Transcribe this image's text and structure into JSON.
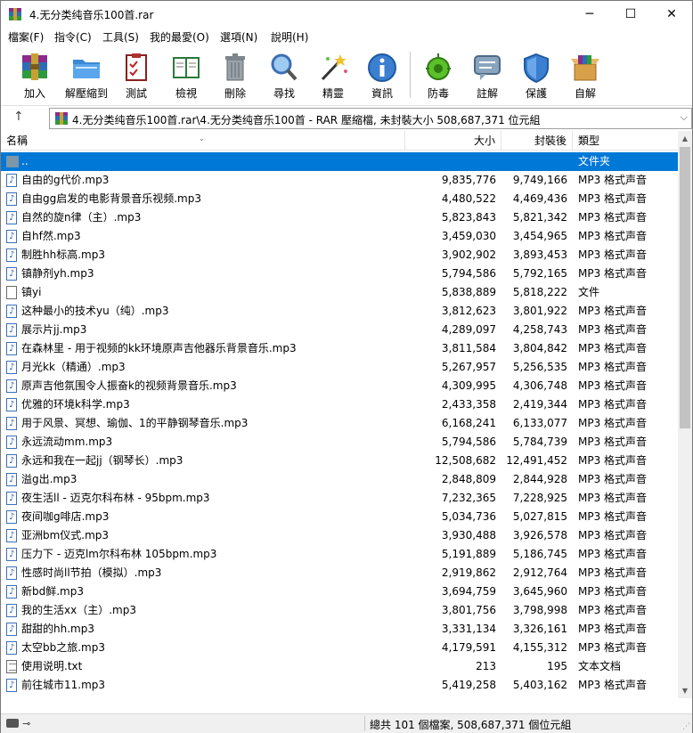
{
  "window": {
    "title": "4.无分类纯音乐100首.rar",
    "min_glyph": "─",
    "max_glyph": "☐",
    "close_glyph": "✕"
  },
  "menu": [
    "檔案(F)",
    "指令(C)",
    "工具(S)",
    "我的最愛(O)",
    "選項(N)",
    "說明(H)"
  ],
  "toolbar": {
    "add": "加入",
    "extract": "解壓縮到",
    "test": "測試",
    "view": "檢視",
    "delete": "刪除",
    "find": "尋找",
    "wizard": "精靈",
    "info": "資訊",
    "virus": "防毒",
    "comment": "註解",
    "protect": "保護",
    "sfx": "自解"
  },
  "address": {
    "up_glyph": "↑",
    "path": "4.无分类纯音乐100首.rar\\4.无分类纯音乐100首 - RAR 壓縮檔, 未封裝大小 508,687,371 位元組",
    "dropdown_glyph": "⌵"
  },
  "columns": {
    "name": "名稱",
    "size": "大小",
    "packed": "封裝後",
    "type": "類型"
  },
  "parent_row": {
    "name": "..",
    "type": "文件夹"
  },
  "files": [
    {
      "name": "自由的g代价.mp3",
      "size": "9,835,776",
      "packed": "9,749,166",
      "type": "MP3 格式声音",
      "kind": "audio"
    },
    {
      "name": "自由gg启发的电影背景音乐视频.mp3",
      "size": "4,480,522",
      "packed": "4,469,436",
      "type": "MP3 格式声音",
      "kind": "audio"
    },
    {
      "name": "自然的旋n律（主）.mp3",
      "size": "5,823,843",
      "packed": "5,821,342",
      "type": "MP3 格式声音",
      "kind": "audio"
    },
    {
      "name": "自hf然.mp3",
      "size": "3,459,030",
      "packed": "3,454,965",
      "type": "MP3 格式声音",
      "kind": "audio"
    },
    {
      "name": "制胜hh标高.mp3",
      "size": "3,902,902",
      "packed": "3,893,453",
      "type": "MP3 格式声音",
      "kind": "audio"
    },
    {
      "name": "镇静剂yh.mp3",
      "size": "5,794,586",
      "packed": "5,792,165",
      "type": "MP3 格式声音",
      "kind": "audio"
    },
    {
      "name": "镇yi",
      "size": "5,838,889",
      "packed": "5,818,222",
      "type": "文件",
      "kind": "plain"
    },
    {
      "name": "这种最小的技术yu（纯）.mp3",
      "size": "3,812,623",
      "packed": "3,801,922",
      "type": "MP3 格式声音",
      "kind": "audio"
    },
    {
      "name": "展示片jj.mp3",
      "size": "4,289,097",
      "packed": "4,258,743",
      "type": "MP3 格式声音",
      "kind": "audio"
    },
    {
      "name": "在森林里 - 用于视频的kk环境原声吉他器乐背景音乐.mp3",
      "size": "3,811,584",
      "packed": "3,804,842",
      "type": "MP3 格式声音",
      "kind": "audio"
    },
    {
      "name": "月光kk（精通）.mp3",
      "size": "5,267,957",
      "packed": "5,256,535",
      "type": "MP3 格式声音",
      "kind": "audio"
    },
    {
      "name": "原声吉他氛围令人振奋k的视频背景音乐.mp3",
      "size": "4,309,995",
      "packed": "4,306,748",
      "type": "MP3 格式声音",
      "kind": "audio"
    },
    {
      "name": "优雅的环境k科学.mp3",
      "size": "2,433,358",
      "packed": "2,419,344",
      "type": "MP3 格式声音",
      "kind": "audio"
    },
    {
      "name": "用于风景、冥想、瑜伽、1的平静钢琴音乐.mp3",
      "size": "6,168,241",
      "packed": "6,133,077",
      "type": "MP3 格式声音",
      "kind": "audio"
    },
    {
      "name": "永远流动mm.mp3",
      "size": "5,794,586",
      "packed": "5,784,739",
      "type": "MP3 格式声音",
      "kind": "audio"
    },
    {
      "name": "永远和我在一起jj（钢琴长）.mp3",
      "size": "12,508,682",
      "packed": "12,491,452",
      "type": "MP3 格式声音",
      "kind": "audio"
    },
    {
      "name": "溢g出.mp3",
      "size": "2,848,809",
      "packed": "2,844,928",
      "type": "MP3 格式声音",
      "kind": "audio"
    },
    {
      "name": "夜生活ll - 迈克尔科布林 - 95bpm.mp3",
      "size": "7,232,365",
      "packed": "7,228,925",
      "type": "MP3 格式声音",
      "kind": "audio"
    },
    {
      "name": "夜间咖g啡店.mp3",
      "size": "5,034,736",
      "packed": "5,027,815",
      "type": "MP3 格式声音",
      "kind": "audio"
    },
    {
      "name": "亚洲bm仪式.mp3",
      "size": "3,930,488",
      "packed": "3,926,578",
      "type": "MP3 格式声音",
      "kind": "audio"
    },
    {
      "name": "压力下 - 迈克lm尔科布林 105bpm.mp3",
      "size": "5,191,889",
      "packed": "5,186,745",
      "type": "MP3 格式声音",
      "kind": "audio"
    },
    {
      "name": "性感时尚ll节拍（模拟）.mp3",
      "size": "2,919,862",
      "packed": "2,912,764",
      "type": "MP3 格式声音",
      "kind": "audio"
    },
    {
      "name": "新bd鲜.mp3",
      "size": "3,694,759",
      "packed": "3,645,960",
      "type": "MP3 格式声音",
      "kind": "audio"
    },
    {
      "name": "我的生活xx（主）.mp3",
      "size": "3,801,756",
      "packed": "3,798,998",
      "type": "MP3 格式声音",
      "kind": "audio"
    },
    {
      "name": "甜甜的hh.mp3",
      "size": "3,331,134",
      "packed": "3,326,161",
      "type": "MP3 格式声音",
      "kind": "audio"
    },
    {
      "name": "太空bb之旅.mp3",
      "size": "4,179,591",
      "packed": "4,155,312",
      "type": "MP3 格式声音",
      "kind": "audio"
    },
    {
      "name": "使用说明.txt",
      "size": "213",
      "packed": "195",
      "type": "文本文档",
      "kind": "text"
    },
    {
      "name": "前往城市11.mp3",
      "size": "5,419,258",
      "packed": "5,403,162",
      "type": "MP3 格式声音",
      "kind": "audio"
    }
  ],
  "status": {
    "text": "總共 101 個檔案, 508,687,371 個位元組"
  },
  "scrollbar": {
    "up_glyph": "▲",
    "down_glyph": "▼",
    "thumb_fraction": 0.5
  },
  "colors": {
    "selection": "#0078d7"
  },
  "icons": {
    "audio": "audio-file-icon",
    "plain": "file-icon",
    "text": "text-file-icon",
    "parent": "parent-folder-icon"
  }
}
